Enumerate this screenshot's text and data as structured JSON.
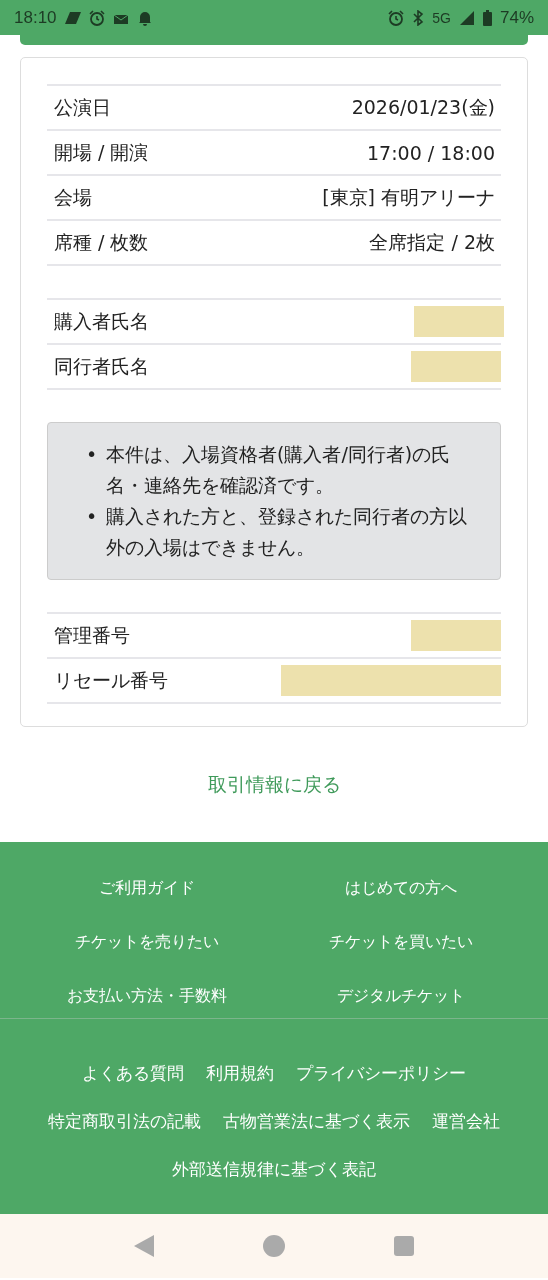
{
  "status_bar": {
    "time": "18:10",
    "network": "5G",
    "battery": "74%"
  },
  "details": [
    {
      "label": "公演日",
      "value": "2026/01/23(金)"
    },
    {
      "label": "開場 / 開演",
      "value": "17:00 / 18:00"
    },
    {
      "label": "会場",
      "value": "[東京] 有明アリーナ"
    },
    {
      "label": "席種 / 枚数",
      "value": "全席指定 / 2枚"
    }
  ],
  "attendees": [
    {
      "label": "購入者氏名",
      "masked": true
    },
    {
      "label": "同行者氏名",
      "masked": true
    }
  ],
  "notice": [
    {
      "marker": "•",
      "text": "本件は、入場資格者(購入者/同行者)の氏名・連絡先を確認済です。"
    },
    {
      "marker": "•",
      "text": "購入された方と、登録された同行者の方以外の入場はできません。"
    }
  ],
  "numbers": [
    {
      "label": "管理番号",
      "masked": true
    },
    {
      "label": "リセール番号",
      "masked": true
    }
  ],
  "back_link": "取引情報に戻る",
  "footer_links": [
    "ご利用ガイド",
    "はじめての方へ",
    "チケットを売りたい",
    "チケットを買いたい",
    "お支払い方法・手数料",
    "デジタルチケット"
  ],
  "footer_legal": [
    "よくある質問",
    "利用規約",
    "プライバシーポリシー",
    "特定商取引法の記載",
    "古物営業法に基づく表示",
    "運営会社",
    "外部送信規律に基づく表記"
  ]
}
